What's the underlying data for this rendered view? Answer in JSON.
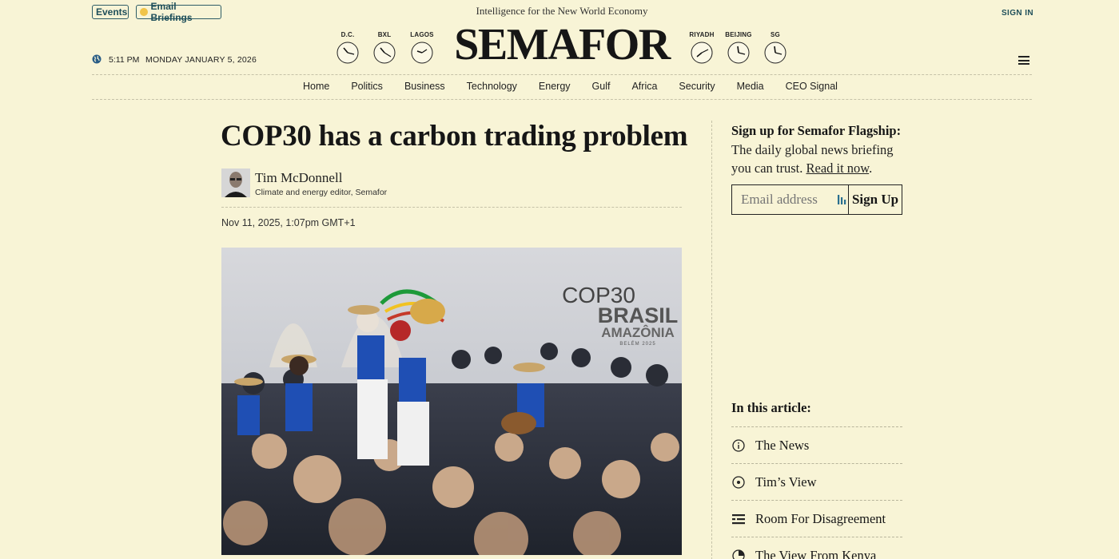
{
  "topbar": {
    "events": "Events",
    "email_briefings": "Email Briefings",
    "tagline": "Intelligence for the New World Economy",
    "sign_in": "SIGN IN"
  },
  "brand": {
    "logo": "SEMAFOR"
  },
  "clocks": [
    {
      "city": "D.C."
    },
    {
      "city": "BXL"
    },
    {
      "city": "LAGOS"
    },
    {
      "city": "RIYADH"
    },
    {
      "city": "BEIJING"
    },
    {
      "city": "SG"
    }
  ],
  "datetime": {
    "time": "5:11 PM",
    "date": "MONDAY JANUARY 5, 2026"
  },
  "nav": [
    "Home",
    "Politics",
    "Business",
    "Technology",
    "Energy",
    "Gulf",
    "Africa",
    "Security",
    "Media",
    "CEO Signal"
  ],
  "article": {
    "headline": "COP30 has a carbon trading problem",
    "author": "Tim McDonnell",
    "role": "Climate and energy editor, Semafor",
    "published": "Nov 11, 2025, 1:07pm GMT+1",
    "photo_sign": {
      "line1": "COP30",
      "line2": "BRASIL",
      "line3": "AMAZÔNIA",
      "line4": "BELÉM 2025"
    }
  },
  "sidebar": {
    "signup_bold": "Sign up for Semafor Flagship:",
    "signup_text": "The daily global news briefing you can trust.",
    "read_link": "Read it now",
    "email_placeholder": "Email address",
    "signup_button": "Sign Up",
    "toc_title": "In this article:",
    "toc": [
      {
        "label": "The News",
        "icon": "info-icon"
      },
      {
        "label": "Tim’s View",
        "icon": "target-icon"
      },
      {
        "label": "Room For Disagreement",
        "icon": "lines-icon"
      },
      {
        "label": "The View From Kenya",
        "icon": "globe-icon"
      }
    ]
  },
  "colors": {
    "background": "#f8f4d6",
    "accent": "#1f4f5a",
    "dot": "#f0c448"
  }
}
